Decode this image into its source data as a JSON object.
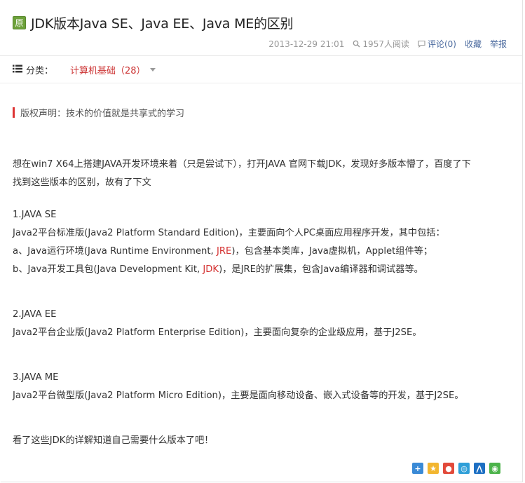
{
  "article": {
    "badge": "原",
    "title": "JDK版本Java SE、Java EE、Java ME的区别",
    "meta": {
      "datetime": "2013-12-29 21:01",
      "views": "1957人阅读",
      "comments": "评论(0)",
      "favorite": "收藏",
      "report": "举报"
    },
    "category": {
      "label": "分类：",
      "value": "计算机基础（28）"
    },
    "copyright": "版权声明：技术的价值就是共享式的学习"
  },
  "content": {
    "intro1": "想在win7 X64上搭建JAVA开发环境来着（只是尝试下），打开JAVA 官网下载JDK，发现好多版本懵了，百度了下",
    "intro2": "找到这些版本的区别，故有了下文",
    "se_head": "1.JAVA SE",
    "se_line1": "Java2平台标准版(Java2 Platform Standard Edition)，主要面向个人PC桌面应用程序开发，其中包括：",
    "se_a_pre": "a、Java运行环境(Java Runtime Environment, ",
    "se_a_link": "JRE",
    "se_a_post": ")，包含基本类库，Java虚拟机，Applet组件等；",
    "se_b_pre": "b、Java开发工具包(Java Development Kit, ",
    "se_b_link": "JDK",
    "se_b_post": ")，是JRE的扩展集，包含Java编译器和调试器等。",
    "ee_head": "2.JAVA EE",
    "ee_line1": "Java2平台企业版(Java2 Platform Enterprise Edition)，主要面向复杂的企业级应用，基于J2SE。",
    "me_head": "3.JAVA ME",
    "me_line1": "Java2平台微型版(Java2 Platform Micro Edition)，主要是面向移动设备、嵌入式设备等的开发，基于J2SE。",
    "outro": "看了这些JDK的详解知道自己需要什么版本了吧！"
  },
  "colors": {
    "accent_red": "#d43030",
    "link_blue": "#4c6b9f",
    "badge_green": "#6da13a"
  },
  "share_icons": [
    "share-more-icon",
    "qzone-icon",
    "weibo-icon",
    "tencent-weibo-icon",
    "renren-icon",
    "wechat-icon"
  ]
}
